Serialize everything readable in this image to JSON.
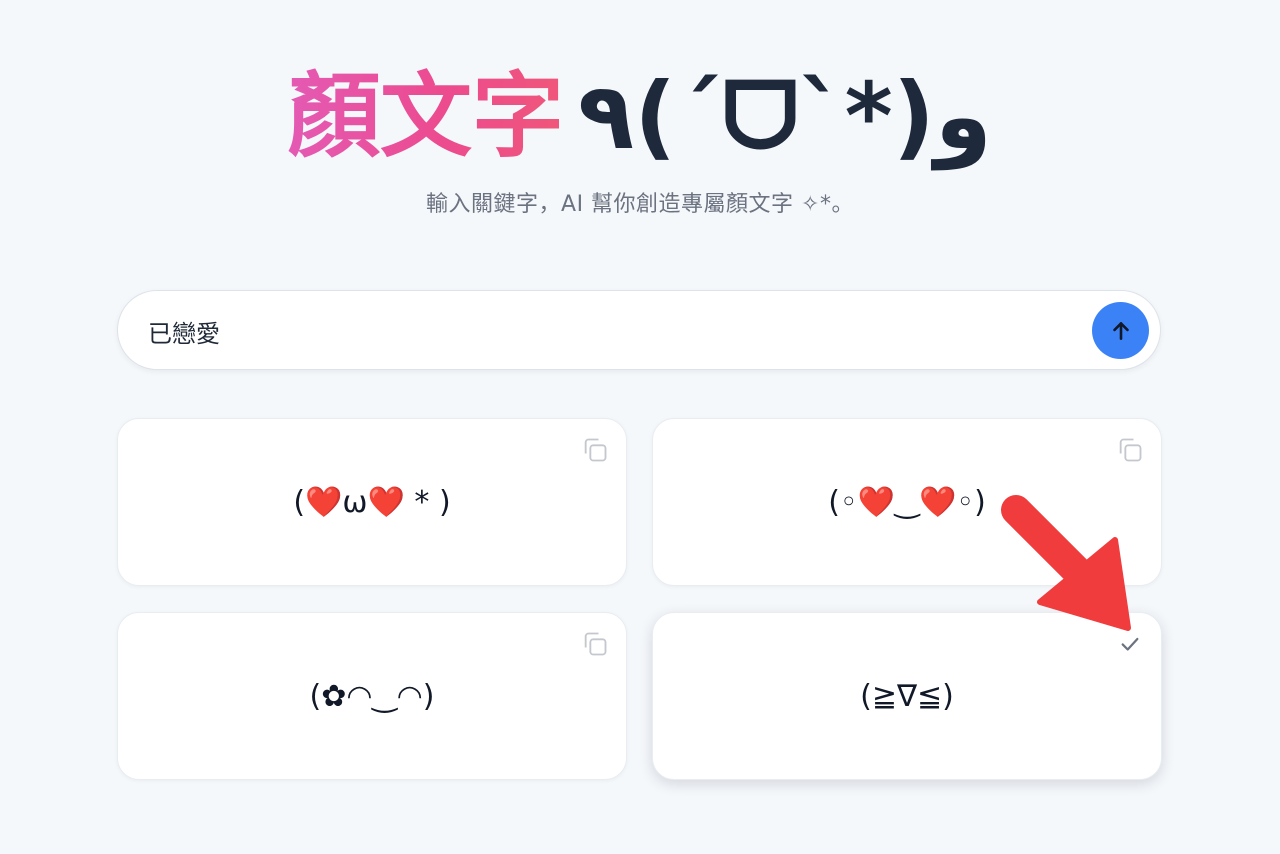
{
  "header": {
    "title_cjk": "顏文字",
    "title_face": "٩(ˊᗜˋ*)و",
    "subtitle": "輸入關鍵字，AI 幫你創造專屬顏文字 ✧*。"
  },
  "search": {
    "value": "已戀愛",
    "submit_icon": "arrow-up-icon"
  },
  "results": [
    {
      "kaomoji": "(❤️ω❤️ * )",
      "icon": "copy-icon",
      "copied": false
    },
    {
      "kaomoji": "(◦❤️‿❤️◦)",
      "icon": "copy-icon",
      "copied": false
    },
    {
      "kaomoji": "(✿◠‿◠)",
      "icon": "copy-icon",
      "copied": false
    },
    {
      "kaomoji": "(≧∇≦)",
      "icon": "check-icon",
      "copied": true
    }
  ],
  "annotation": {
    "icon": "red-arrow-icon",
    "color": "#f03c3c"
  },
  "colors": {
    "accent": "#3b82f6",
    "title_gradient_start": "#e45ab4",
    "title_gradient_end": "#f0567a"
  }
}
